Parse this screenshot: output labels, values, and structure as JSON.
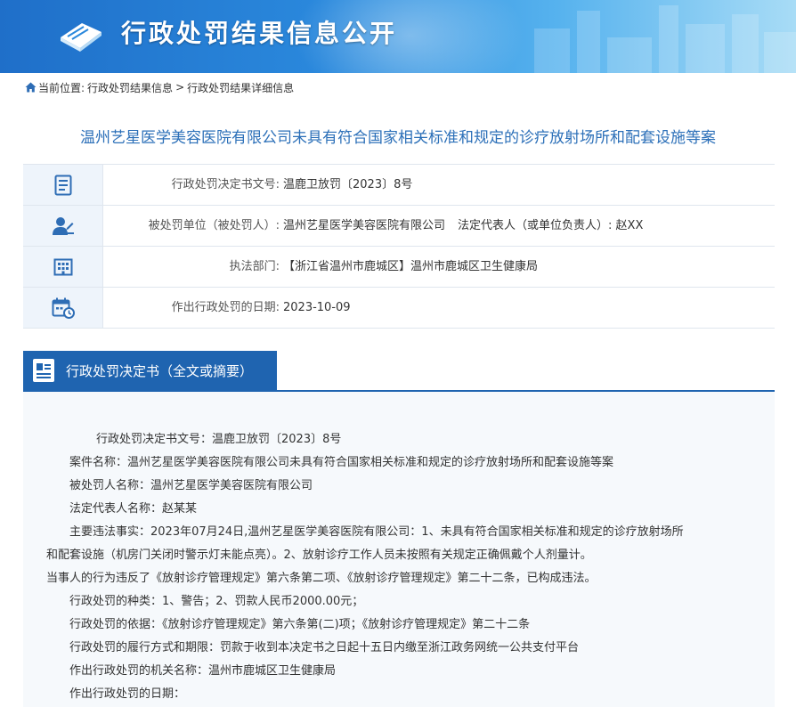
{
  "banner": {
    "title": "行政处罚结果信息公开"
  },
  "breadcrumb": {
    "prefix": "当前位置:",
    "items": [
      "行政处罚结果信息",
      "行政处罚结果详细信息"
    ],
    "separator": ">"
  },
  "page_title": "温州艺星医学美容医院有限公司未具有符合国家相关标准和规定的诊疗放射场所和配套设施等案",
  "info": {
    "doc_no_label": "行政处罚决定书文号:",
    "doc_no": "温鹿卫放罚〔2023〕8号",
    "party_label": "被处罚单位（被处罚人）:",
    "party": "温州艺星医学美容医院有限公司",
    "rep_label": "法定代表人（或单位负责人）:",
    "rep": "赵XX",
    "dept_label": "执法部门:",
    "dept": "【浙江省温州市鹿城区】温州市鹿城区卫生健康局",
    "date_label": "作出行政处罚的日期:",
    "date": "2023-10-09"
  },
  "section": {
    "title": "行政处罚决定书（全文或摘要）"
  },
  "content": {
    "p1": "行政处罚决定书文号：温鹿卫放罚〔2023〕8号",
    "p2": "案件名称：温州艺星医学美容医院有限公司未具有符合国家相关标准和规定的诊疗放射场所和配套设施等案",
    "p3": "被处罚人名称：温州艺星医学美容医院有限公司",
    "p4": "法定代表人名称：赵某某",
    "p5a": "主要违法事实：2023年07月24日,温州艺星医学美容医院有限公司：1、未具有符合国家相关标准和规定的诊疗放射场所",
    "p5b": "和配套设施（机房门关闭时警示灯未能点亮）。2、放射诊疗工作人员未按照有关规定正确佩戴个人剂量计。",
    "p5c": "当事人的行为违反了《放射诊疗管理规定》第六条第二项、《放射诊疗管理规定》第二十二条，已构成违法。",
    "p6": "行政处罚的种类：1、警告；2、罚款人民币2000.00元；",
    "p7": "行政处罚的依据：《放射诊疗管理规定》第六条第(二)项；《放射诊疗管理规定》第二十二条",
    "p8": "行政处罚的履行方式和期限：罚款于收到本决定书之日起十五日内缴至浙江政务网统一公共支付平台",
    "p9": "作出行政处罚的机关名称：温州市鹿城区卫生健康局",
    "p10": "作出行政处罚的日期："
  },
  "colors": {
    "brand_blue": "#1f64b0",
    "title_blue": "#2b6fb8",
    "icon_blue": "#2e6db5"
  }
}
